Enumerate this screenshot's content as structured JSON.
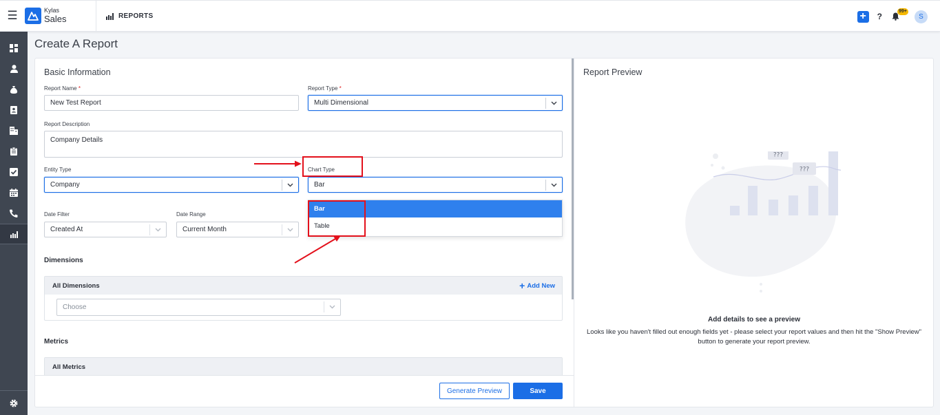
{
  "header": {
    "brand_small": "Kylas",
    "brand_big": "Sales",
    "module": "REPORTS",
    "help": "?",
    "notifications_badge": "99+",
    "avatar_initial": "S"
  },
  "sidebar": {
    "items": [
      "dashboard-icon",
      "person-icon",
      "money-bag-icon",
      "contact-card-icon",
      "building-icon",
      "clipboard-icon",
      "checkbox-icon",
      "calendar-icon",
      "phone-icon",
      "reports-icon"
    ],
    "footer_icon": "gear-icon"
  },
  "page": {
    "title": "Create A Report"
  },
  "form": {
    "section_title": "Basic Information",
    "report_name_label": "Report Name",
    "report_name_value": "New Test Report",
    "report_type_label": "Report Type",
    "report_type_value": "Multi Dimensional",
    "required_mark": "*",
    "description_label": "Report Description",
    "description_value": "Company Details",
    "entity_type_label": "Entity Type",
    "entity_type_value": "Company",
    "chart_type_label": "Chart Type",
    "chart_type_value": "Bar",
    "chart_type_options": [
      "Bar",
      "Table"
    ],
    "date_filter_label": "Date Filter",
    "date_filter_value": "Created At",
    "date_range_label": "Date Range",
    "date_range_value": "Current Month",
    "dimensions_title": "Dimensions",
    "all_dimensions": "All Dimensions",
    "add_new": "Add New",
    "choose_placeholder": "Choose",
    "metrics_title": "Metrics",
    "all_metrics": "All Metrics"
  },
  "footer": {
    "generate_preview": "Generate Preview",
    "save": "Save"
  },
  "preview": {
    "title": "Report Preview",
    "bubble_text": "???",
    "heading": "Add details to see a preview",
    "text": "Looks like you haven't filled out enough fields yet - please select your report values and then hit the \"Show Preview\" button to generate your report preview."
  },
  "colors": {
    "primary": "#1b6ee6",
    "sidebar": "#3f4651",
    "annotation": "#e3101b",
    "selected_option": "#2f80ed"
  }
}
